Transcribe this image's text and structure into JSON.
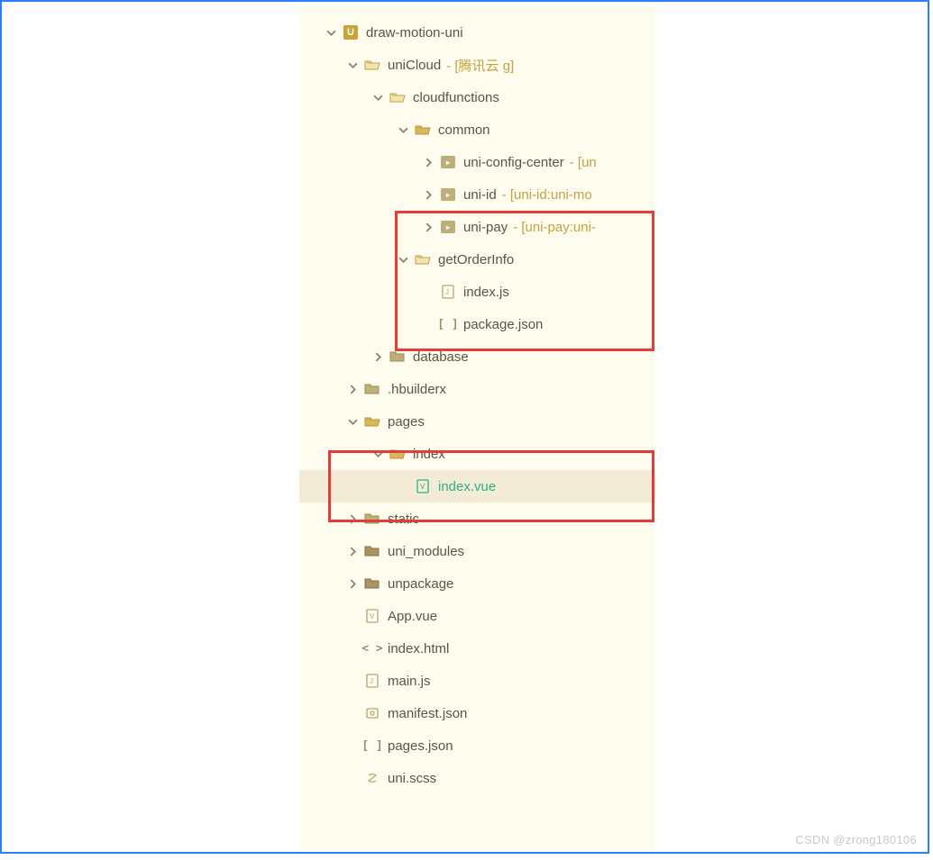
{
  "watermark": "CSDN @zrong180106",
  "tree": {
    "root": {
      "label": "draw-motion-uni",
      "children": {
        "uniCloud": {
          "label": "uniCloud",
          "suffix": "- [腾讯云           g]",
          "cloudfunctions": {
            "label": "cloudfunctions",
            "common": {
              "label": "common",
              "uniConfigCenter": {
                "label": "uni-config-center",
                "suffix": "- [un"
              },
              "uniId": {
                "label": "uni-id",
                "suffix": "- [uni-id:uni-mo"
              },
              "uniPay": {
                "label": "uni-pay",
                "suffix": "- [uni-pay:uni-"
              }
            },
            "getOrderInfo": {
              "label": "getOrderInfo",
              "indexJs": {
                "label": "index.js"
              },
              "packageJson": {
                "label": "package.json"
              }
            }
          },
          "database": {
            "label": "database"
          }
        },
        "hbuilderx": {
          "label": ".hbuilderx"
        },
        "pages": {
          "label": "pages",
          "index": {
            "label": "index",
            "indexVue": {
              "label": "index.vue"
            }
          }
        },
        "static": {
          "label": "static"
        },
        "uniModules": {
          "label": "uni_modules"
        },
        "unpackage": {
          "label": "unpackage"
        },
        "appVue": {
          "label": "App.vue"
        },
        "indexHtml": {
          "label": "index.html"
        },
        "mainJs": {
          "label": "main.js"
        },
        "manifestJson": {
          "label": "manifest.json"
        },
        "pagesJson": {
          "label": "pages.json"
        },
        "uniScss": {
          "label": "uni.scss"
        }
      }
    }
  }
}
